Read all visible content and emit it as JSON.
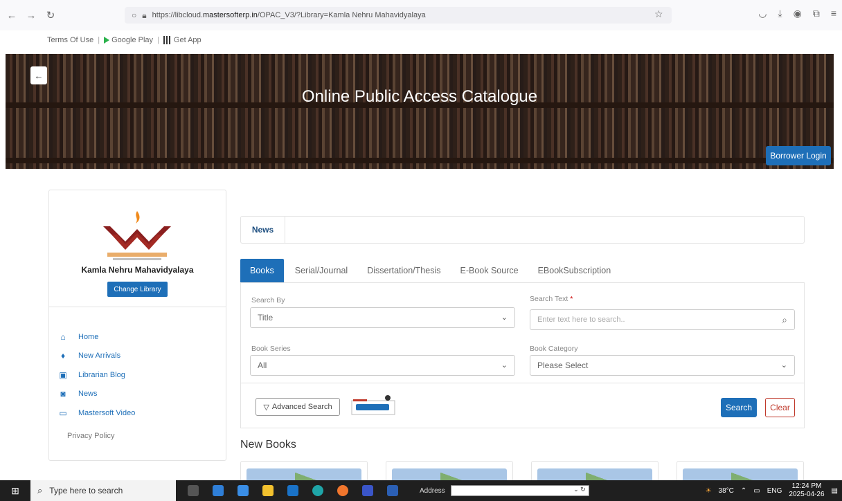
{
  "browser": {
    "url_prefix": "https://libcloud.",
    "url_domain": "mastersofterp.in",
    "url_suffix": "/OPAC_V3/?Library=Kamla Nehru Mahavidyalaya"
  },
  "top_links": {
    "terms": "Terms Of Use",
    "google_play": "Google Play",
    "get_app": "Get App"
  },
  "banner": {
    "title": "Online Public Access Catalogue",
    "login_label": "Borrower Login"
  },
  "sidebar": {
    "library_name": "Kamla Nehru Mahavidyalaya",
    "change_library": "Change Library",
    "items": [
      {
        "label": "Home",
        "icon": "home-icon",
        "glyph": "⌂"
      },
      {
        "label": "New Arrivals",
        "icon": "gem-icon",
        "glyph": "♦"
      },
      {
        "label": "Librarian Blog",
        "icon": "book-icon",
        "glyph": "▣"
      },
      {
        "label": "News",
        "icon": "document-icon",
        "glyph": "◙"
      },
      {
        "label": "Mastersoft Video",
        "icon": "folder-open-icon",
        "glyph": "▭"
      }
    ],
    "privacy": "Privacy Policy"
  },
  "news": {
    "tab_label": "News"
  },
  "tabs": [
    {
      "label": "Books",
      "active": true
    },
    {
      "label": "Serial/Journal",
      "active": false
    },
    {
      "label": "Dissertation/Thesis",
      "active": false
    },
    {
      "label": "E-Book Source",
      "active": false
    },
    {
      "label": "EBookSubscription",
      "active": false
    }
  ],
  "search": {
    "search_by_label": "Search By",
    "search_by_value": "Title",
    "search_text_label": "Search Text",
    "search_text_required": "*",
    "search_text_placeholder": "Enter text here to search..",
    "book_series_label": "Book Series",
    "book_series_value": "All",
    "book_category_label": "Book Category",
    "book_category_value": "Please Select",
    "advanced_label": "Advanced Search",
    "search_button": "Search",
    "clear_button": "Clear"
  },
  "new_books": {
    "heading": "New Books"
  },
  "taskbar": {
    "search_placeholder": "Type here to search",
    "address_label": "Address",
    "temperature": "38°C",
    "language": "ENG",
    "time": "12:24 PM",
    "date": "2025-04-26"
  },
  "colors": {
    "primary": "#1e6fb8",
    "danger": "#c0392b"
  }
}
